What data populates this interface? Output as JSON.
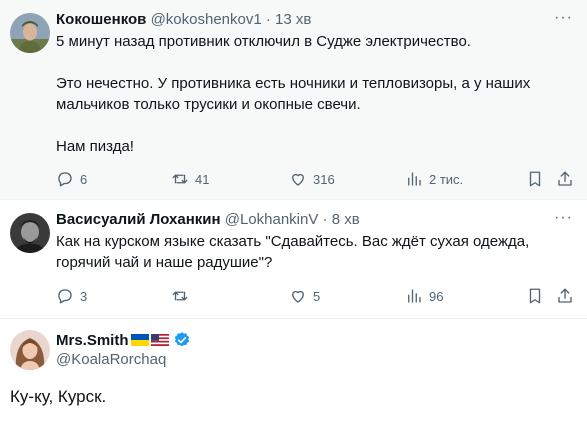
{
  "tweets": [
    {
      "name": "Кокошенков",
      "handle": "@kokoshenkov1",
      "time": "13 хв",
      "text": "5 минут назад противник отключил в Судже электричество.\n\nЭто нечестно. У противника есть ночники и тепловизоры, а у наших\nмальчиков только трусики и окопные свечи.\n\nНам пизда!",
      "replies": "6",
      "retweets": "41",
      "likes": "316",
      "views": "2 тис."
    },
    {
      "name": "Васисуалий Лоханкин",
      "handle": "@LokhankinV",
      "time": "8 хв",
      "text": "Как на курском языке сказать \"Сдавайтесь. Вас ждёт сухая одежда,\nгорячий чай и наше радушие\"?",
      "replies": "3",
      "retweets": "",
      "likes": "5",
      "views": "96"
    },
    {
      "name": "Mrs.Smith",
      "handle": "@KoalaRorchaq",
      "text": "Ку-ку, Курск."
    }
  ],
  "ui": {
    "separator": "·",
    "more": "···"
  },
  "icons": [
    "reply-icon",
    "retweet-icon",
    "like-icon",
    "views-icon",
    "bookmark-icon",
    "share-icon",
    "verified-icon",
    "ukraine-flag-icon",
    "us-flag-icon"
  ],
  "colors": {
    "text": "#0f1419",
    "muted": "#536471",
    "verified": "#1d9bf0",
    "highlight_bg": "#f7f9f9"
  }
}
